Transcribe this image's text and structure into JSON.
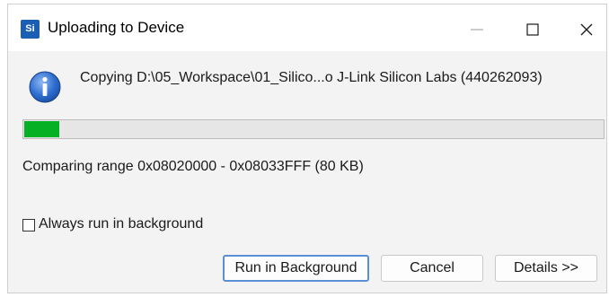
{
  "window": {
    "title": "Uploading to Device",
    "app_icon_text": "Si",
    "controls": {
      "minimize_icon": "minimize-icon",
      "maximize_icon": "maximize-icon",
      "close_icon": "close-icon"
    }
  },
  "message": {
    "icon": "info-icon",
    "text": "Copying D:\\05_Workspace\\01_Silico...o J-Link Silicon Labs (440262093)"
  },
  "progress": {
    "fraction": 0.06,
    "fill_color": "#06b025"
  },
  "status": {
    "text": "Comparing range 0x08020000 - 0x08033FFF (80 KB)"
  },
  "checkbox": {
    "label": "Always run in background",
    "checked": false
  },
  "buttons": {
    "run_in_background": "Run in Background",
    "cancel": "Cancel",
    "details": "Details >>"
  },
  "colors": {
    "accent": "#1a5fb4",
    "info_blue": "#2f6fd1"
  }
}
